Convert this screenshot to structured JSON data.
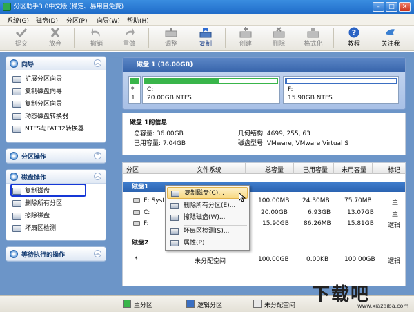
{
  "window": {
    "title": "分区助手3.0中文版 (稳定、易用且免费)",
    "btn_min": "–",
    "btn_max": "□",
    "btn_close": "✕"
  },
  "menu": [
    "系统(G)",
    "磁盘(D)",
    "分区(P)",
    "向导(W)",
    "帮助(H)"
  ],
  "toolbar": {
    "submit": "提交",
    "discard": "放弃",
    "undo": "撤销",
    "redo": "重做",
    "adjust": "调整",
    "copy": "复制",
    "create": "创建",
    "delete": "删除",
    "format": "格式化",
    "tutorial": "教程",
    "about": "关注我"
  },
  "wizard": {
    "title": "向导",
    "items": [
      "扩展分区向导",
      "复制磁盘向导",
      "复制分区向导",
      "动态磁盘转换器",
      "NTFS与FAT32转换器"
    ]
  },
  "partition_ops": {
    "title": "分区操作"
  },
  "disk_ops": {
    "title": "磁盘操作",
    "items": [
      "复制磁盘",
      "删除所有分区",
      "擦除磁盘",
      "坏扇区检测"
    ]
  },
  "pending": {
    "title": "等待执行的操作"
  },
  "disk_map": {
    "header": "磁盘 1 (36.00GB)",
    "p1_letter": "*",
    "p1_index": "1",
    "p1_drive": "C:",
    "p1_info": "20.00GB NTFS",
    "p2_drive": "F:",
    "p2_info": "15.90GB NTFS",
    "p1_used_fraction": 0.56,
    "p2_used_fraction": 0.01
  },
  "disk_info": {
    "title": "磁盘 1的信息",
    "total_label": "总容量: 36.00GB",
    "used_label": "已用容量: 7.04GB",
    "geometry": "几何结构: 4699, 255, 63",
    "model": "磁盘型号: VMware, VMware Virtual S"
  },
  "table": {
    "headers": [
      "分区",
      "文件系统",
      "总容量",
      "已用容量",
      "未用容量",
      "标记"
    ],
    "group1": "磁盘1",
    "group2": "磁盘2",
    "rows": [
      {
        "part": "E:  Syster",
        "size": "100.00MB",
        "used": "24.30MB",
        "free": "75.70MB",
        "flag": "主"
      },
      {
        "part": "C:",
        "size": "20.00GB",
        "used": "6.93GB",
        "free": "13.07GB",
        "flag": "主"
      },
      {
        "part": "F:",
        "size": "15.90GB",
        "used": "86.26MB",
        "free": "15.81GB",
        "flag": "逻辑"
      },
      {
        "part": "*",
        "fs": "未分配空间",
        "size": "100.00GB",
        "used": "0.00KB",
        "free": "100.00GB",
        "flag": "逻辑"
      }
    ]
  },
  "context_menu": [
    "复制磁盘(C)...",
    "删除所有分区(E)...",
    "擦除磁盘(W)...",
    "坏扇区检测(S)...",
    "属性(P)"
  ],
  "legend": [
    "主分区",
    "逻辑分区",
    "未分配空间"
  ],
  "watermark": {
    "text": "下载吧",
    "url": "www.xiazaiba.com"
  },
  "colors": {
    "primary": "#39b54a",
    "logical": "#3b6fc2",
    "unallocated": "#e8e8e8",
    "selection": "#2b63b1"
  }
}
